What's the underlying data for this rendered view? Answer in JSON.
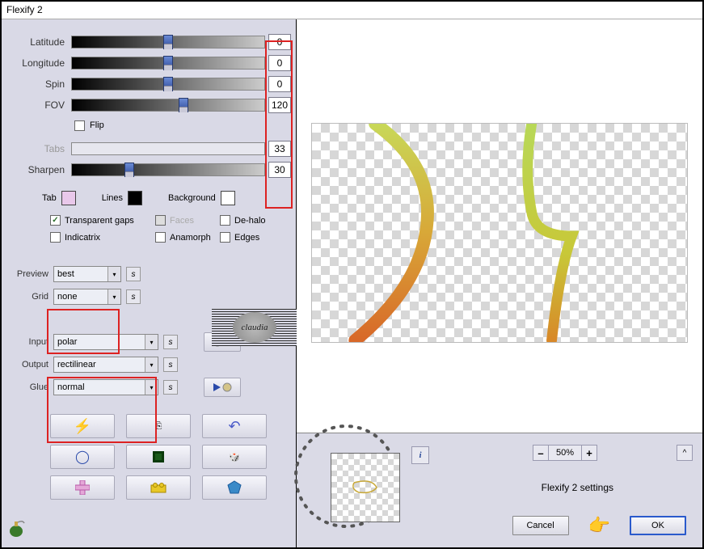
{
  "title": "Flexify 2",
  "sliders": {
    "latitude": {
      "label": "Latitude",
      "value": "0",
      "pos": 50,
      "disabled": false
    },
    "longitude": {
      "label": "Longitude",
      "value": "0",
      "pos": 50,
      "disabled": false
    },
    "spin": {
      "label": "Spin",
      "value": "0",
      "pos": 50,
      "disabled": false
    },
    "fov": {
      "label": "FOV",
      "value": "120",
      "pos": 58,
      "disabled": false
    },
    "tabs": {
      "label": "Tabs",
      "value": "33",
      "pos": 0,
      "disabled": true
    },
    "sharpen": {
      "label": "Sharpen",
      "value": "30",
      "pos": 30,
      "disabled": false
    }
  },
  "flip": {
    "label": "Flip",
    "checked": false
  },
  "colors": {
    "tab_label": "Tab",
    "tab_color": "#e9c8ea",
    "lines_label": "Lines",
    "lines_color": "#000000",
    "bg_label": "Background",
    "bg_color": "#ffffff"
  },
  "checks": {
    "transparent_gaps": {
      "label": "Transparent gaps",
      "checked": true
    },
    "faces": {
      "label": "Faces",
      "checked": false,
      "disabled": true
    },
    "dehalo": {
      "label": "De-halo",
      "checked": false
    },
    "indicatrix": {
      "label": "Indicatrix",
      "checked": false
    },
    "anamorph": {
      "label": "Anamorph",
      "checked": false
    },
    "edges": {
      "label": "Edges",
      "checked": false
    }
  },
  "dropdowns": {
    "preview": {
      "label": "Preview",
      "value": "best"
    },
    "grid": {
      "label": "Grid",
      "value": "none"
    },
    "input": {
      "label": "Input",
      "value": "polar"
    },
    "output": {
      "label": "Output",
      "value": "rectilinear"
    },
    "glue": {
      "label": "Glue",
      "value": "normal"
    }
  },
  "logo_text": "claudia",
  "zoom": {
    "value": "50%",
    "minus": "–",
    "plus": "+"
  },
  "settings_label": "Flexify 2 settings",
  "buttons": {
    "cancel": "Cancel",
    "ok": "OK"
  },
  "expand": "^",
  "info": "i",
  "icons": {
    "swap": "s",
    "rec_play": "rec-play-icon",
    "play_next": "play-next-icon",
    "lightning": "lightning-icon",
    "copy": "copy-icon",
    "undo": "undo-icon",
    "donut": "donut-icon",
    "square": "square-icon",
    "dice": "dice-icon",
    "plus_shape": "plus-shape-icon",
    "brick": "brick-icon",
    "gem": "gem-icon",
    "hand": "hand-point-icon",
    "grenade": "grenade-icon"
  }
}
